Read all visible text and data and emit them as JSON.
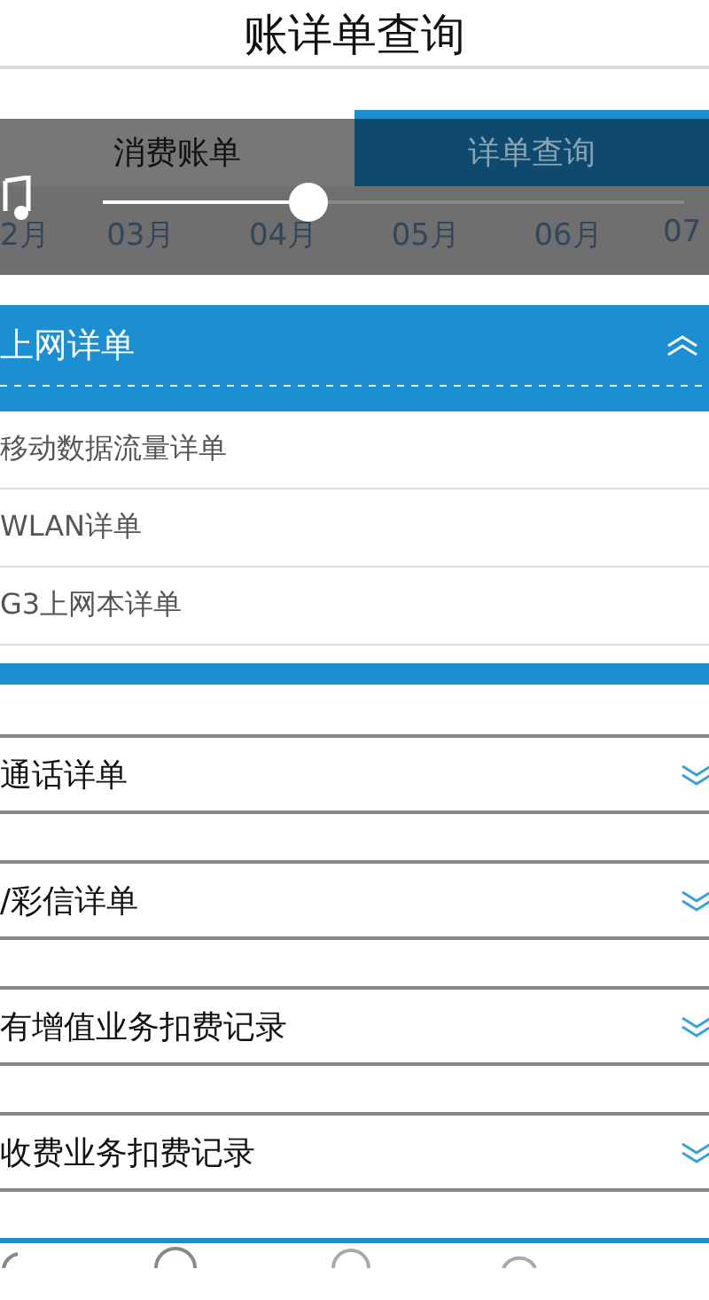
{
  "header": {
    "title": "账详单查询"
  },
  "tabs": [
    {
      "label": "消费账单",
      "selected": false
    },
    {
      "label": "详单查询",
      "selected": true
    }
  ],
  "month_slider": {
    "level": 0.33,
    "months": [
      "2月",
      "03月",
      "04月",
      "05月",
      "06月",
      "07"
    ]
  },
  "sections": [
    {
      "title": "上网详单",
      "expanded": true,
      "items": [
        "移动数据流量详单",
        "WLAN详单",
        "G3上网本详单"
      ]
    },
    {
      "title": "通话详单",
      "expanded": false
    },
    {
      "title": "/彩信详单",
      "expanded": false
    },
    {
      "title": "有增值业务扣费记录",
      "expanded": false
    },
    {
      "title": "收费业务扣费记录",
      "expanded": false
    }
  ]
}
